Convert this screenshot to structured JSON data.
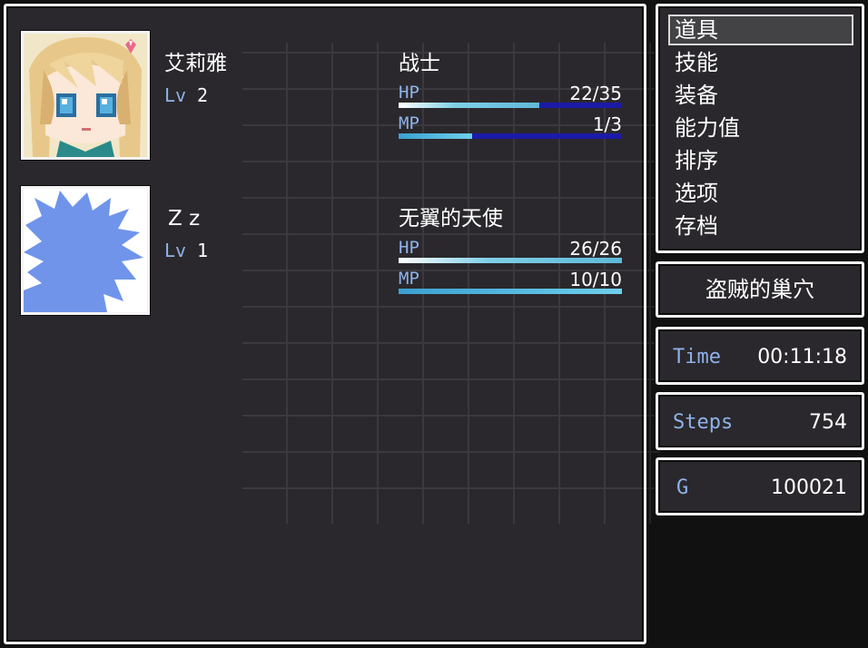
{
  "party": [
    {
      "name": "艾莉雅",
      "level_label": "Lv",
      "level": "2",
      "class": "战士",
      "hp_label": "HP",
      "hp_text": "22/35",
      "hp_fraction": 0.63,
      "mp_label": "MP",
      "mp_text": "1/3",
      "mp_fraction": 0.33,
      "portrait": "blonde-girl-portrait"
    },
    {
      "name": "Z z",
      "level_label": "Lv",
      "level": "1",
      "class": "无翼的天使",
      "hp_label": "HP",
      "hp_text": "26/26",
      "hp_fraction": 1.0,
      "mp_label": "MP",
      "mp_text": "10/10",
      "mp_fraction": 1.0,
      "portrait": "blue-silhouette-portrait"
    }
  ],
  "menu": {
    "items": [
      "道具",
      "技能",
      "装备",
      "能力值",
      "排序",
      "选项",
      "存档"
    ],
    "selected": "道具"
  },
  "location": "盗贼的巢穴",
  "time": {
    "label": "Time",
    "value": "00:11:18"
  },
  "steps": {
    "label": "Steps",
    "value": "754"
  },
  "gold": {
    "label": "G",
    "value": "100021"
  },
  "colors": {
    "window_bg": "#2a282c",
    "system_blue": "#8fb2ea",
    "gauge_back": "#1c1aa8",
    "hp_gauge": "#6fd0ee",
    "mp_gauge": "#3aa0d0"
  }
}
